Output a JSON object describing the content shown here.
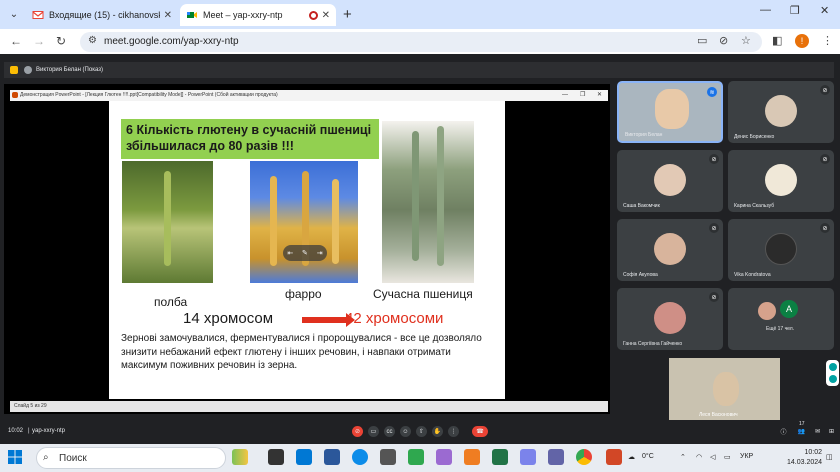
{
  "browser": {
    "tabs": [
      {
        "label": "Входящие (15) - cikhanovskaja...",
        "active": false
      },
      {
        "label": "Meet – yap-xxry-ntp",
        "active": true
      }
    ],
    "url": "meet.google.com/yap-xxry-ntp",
    "profile_letter": "!"
  },
  "meet": {
    "presenter_label": "Виктория Белан (Показ)",
    "meeting_code": "yap-xxry-ntp",
    "time": "10:02",
    "participants_count": "17",
    "participants": [
      {
        "name": "Виктория Белан",
        "color": "#c9c6c0"
      },
      {
        "name": "Денис Борисенко",
        "color": "#d9c8b5"
      },
      {
        "name": "Саша Вакомчик",
        "color": "#e2c9b5"
      },
      {
        "name": "Карина Скальзуб",
        "color": "#f0e8d8"
      },
      {
        "name": "Софія Акулова",
        "color": "#d8b49c"
      },
      {
        "name": "Vika Kondratova",
        "color": "#2b2b2b"
      },
      {
        "name": "Ганна Сергіївна Гайченко",
        "color": "#cf8f86"
      },
      {
        "name": "Ещё 17 чел.",
        "letter": "A"
      }
    ],
    "self_name": "Леся Васюнович"
  },
  "powerpoint": {
    "window_title": "Демонстрация PowerPoint - [Лекция Глютен !!!!.ppt[Compatibility Mode]] - PowerPoint (Сбой активации продукта)",
    "status": "Слайд 5 из 29"
  },
  "slide": {
    "title_number": "6",
    "title": "Кількість глютену в сучасній пшениці збільшилася до 80 разів !!!",
    "captions": [
      "полба",
      "фарро",
      "Сучасна пшениця"
    ],
    "chromosomes_from": "14 хромосом",
    "chromosomes_to": "42 хромосоми",
    "body": "Зернові замочувалися, ферментувалися і пророщувалися - все це дозволяло знизити небажаний ефект глютену і інших речовин, і навпаки отримати максимум поживних речовин із зерна."
  },
  "taskbar": {
    "search_label": "Поиск",
    "temperature": "0°C",
    "language": "УКР",
    "time": "10:02",
    "date": "14.03.2024"
  },
  "colors": {
    "slide_title_bg": "#92d050",
    "accent_red": "#e0301e",
    "meet_bg": "#202124"
  }
}
